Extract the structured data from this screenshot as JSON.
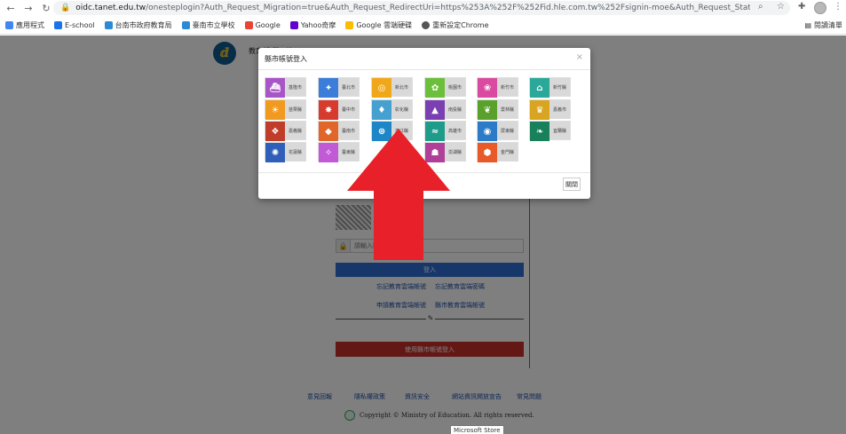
{
  "browser": {
    "url_host": "oidc.tanet.edu.tw",
    "url_rest": "/onesteplogin?Auth_Request_Migration=true&Auth_Request_RedirectUri=https%253A%252F%252Fid.hle.com.tw%252Fsignin-moe&Auth_Request_State=CfDJ8B7Q...",
    "bookmarks": [
      {
        "label": "應用程式",
        "color": "#4285f4"
      },
      {
        "label": "E-school",
        "color": "#1a73e8"
      },
      {
        "label": "台南市政府教育局",
        "color": "#2b8ad6"
      },
      {
        "label": "臺南市立學校",
        "color": "#2b8ad6"
      },
      {
        "label": "Google",
        "color": "#ea4335"
      },
      {
        "label": "Yahoo奇摩",
        "color": "#6001d2"
      },
      {
        "label": "Google 雲端硬碟",
        "color": "#fbbc04"
      },
      {
        "label": "重新設定Chrome",
        "color": "#555555"
      }
    ],
    "bookmarks_right": "閱讀清單"
  },
  "page": {
    "site_name": "教育部 單一簽入",
    "password_placeholder": "請輸入驗證碼",
    "login_label": "登入",
    "links": {
      "forgot_id": "忘記教育雲端帳號",
      "forgot_password": "忘記教育雲端密碼",
      "apply_account": "申請教育雲端帳號",
      "county_account": "縣市教育雲端帳號"
    },
    "county_button": "使用縣市帳號登入",
    "footer_links": [
      "意見回報",
      "隱私權政策",
      "資訊安全",
      "網站資訊開放宣告",
      "常見問題"
    ],
    "copyright": "Copyright © Ministry of Education. All rights reserved.",
    "tooltip": "Microsoft Store"
  },
  "modal": {
    "title": "縣市帳號登入",
    "close_button": "關閉",
    "tiles": [
      {
        "label": "基隆市",
        "color": "#a855c8",
        "glyph": "⛴"
      },
      {
        "label": "臺北市",
        "color": "#3b7dd8",
        "glyph": "✦"
      },
      {
        "label": "新北市",
        "color": "#f0a81a",
        "glyph": "◎"
      },
      {
        "label": "桃園市",
        "color": "#6cbf3a",
        "glyph": "✿"
      },
      {
        "label": "新竹市",
        "color": "#d94aa0",
        "glyph": "❀"
      },
      {
        "label": "新竹縣",
        "color": "#2aa89a",
        "glyph": "⌂"
      },
      {
        "label": "苗栗縣",
        "color": "#f29a1f",
        "glyph": "☀"
      },
      {
        "label": "臺中市",
        "color": "#d63b2e",
        "glyph": "✸"
      },
      {
        "label": "彰化縣",
        "color": "#46a0d0",
        "glyph": "♦"
      },
      {
        "label": "南投縣",
        "color": "#7a3fb0",
        "glyph": "▲"
      },
      {
        "label": "雲林縣",
        "color": "#5aa02c",
        "glyph": "❦"
      },
      {
        "label": "嘉義市",
        "color": "#d9a520",
        "glyph": "♛"
      },
      {
        "label": "嘉義縣",
        "color": "#c03d2a",
        "glyph": "❖"
      },
      {
        "label": "臺南市",
        "color": "#e0662a",
        "glyph": "◆"
      },
      {
        "label": "高雄市",
        "color": "#1f9b8a",
        "glyph": "≈"
      },
      {
        "label": "屏東縣",
        "color": "#2b7bc8",
        "glyph": "◉"
      },
      {
        "label": "宜蘭縣",
        "color": "#18805a",
        "glyph": "❧"
      },
      {
        "label": "花蓮縣",
        "color": "#2f5fb8",
        "glyph": "✺"
      },
      {
        "label": "臺東縣",
        "color": "#c25ad6",
        "glyph": "✧"
      },
      {
        "label": "澎湖縣",
        "color": "#b03f9a",
        "glyph": "☗"
      },
      {
        "label": "金門縣",
        "color": "#e85a2a",
        "glyph": "⬢"
      },
      {
        "label": "連江縣",
        "color": "#1d86c6",
        "glyph": "⊛"
      }
    ]
  },
  "annotation": {
    "arrow_color": "#e8202a"
  }
}
